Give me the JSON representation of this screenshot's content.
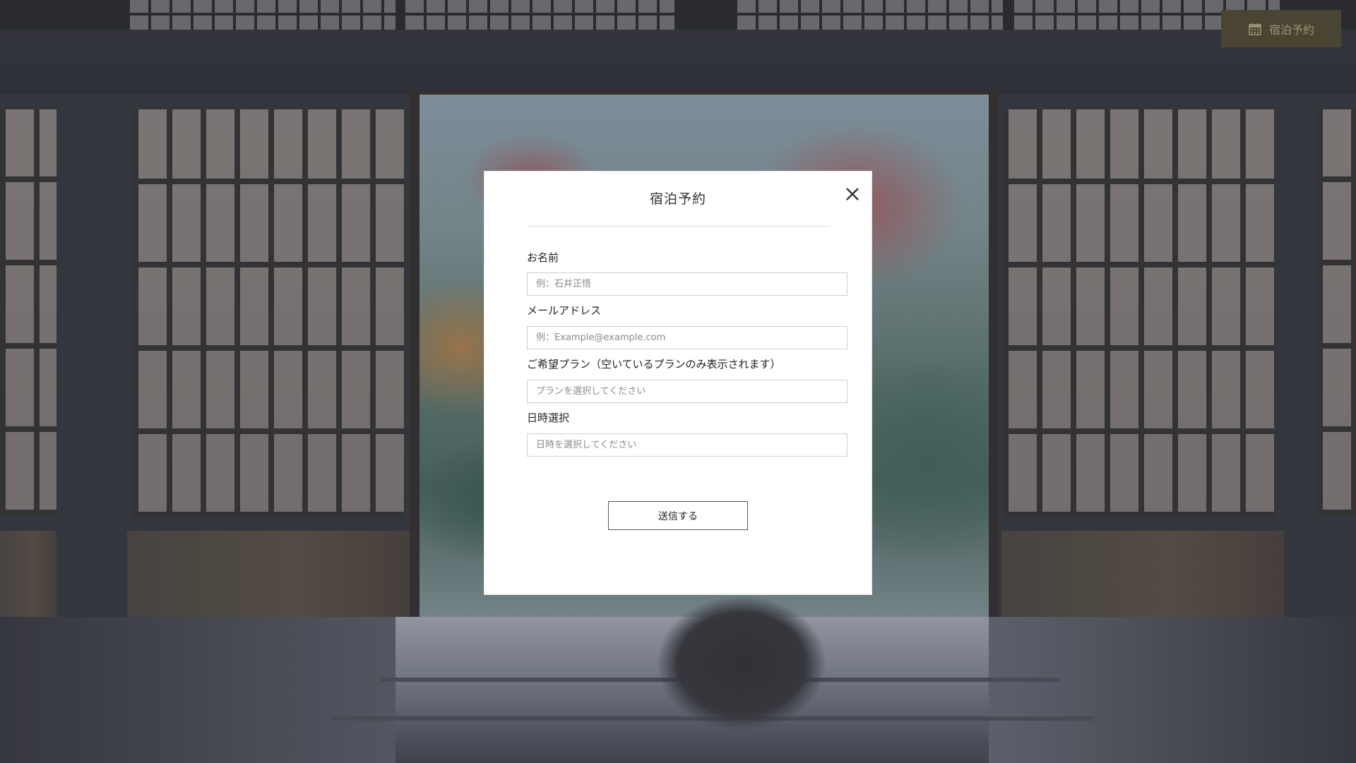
{
  "header": {
    "reserve_button_label": "宿泊予約",
    "reserve_icon": "calendar-icon"
  },
  "modal": {
    "title": "宿泊予約",
    "close_icon": "close-icon",
    "fields": {
      "name": {
        "label": "お名前",
        "placeholder": "例：石井正悟"
      },
      "email": {
        "label": "メールアドレス",
        "placeholder": "例：Example@example.com"
      },
      "plan": {
        "label": "ご希望プラン（空いているプランのみ表示されます）",
        "placeholder": "プランを選択してください"
      },
      "date": {
        "label": "日時選択",
        "placeholder": "日時を選択してください"
      }
    },
    "submit_label": "送信する"
  },
  "colors": {
    "reserve_button_bg": "#4a4532",
    "reserve_button_text": "#9a9375",
    "modal_bg": "#ffffff"
  }
}
